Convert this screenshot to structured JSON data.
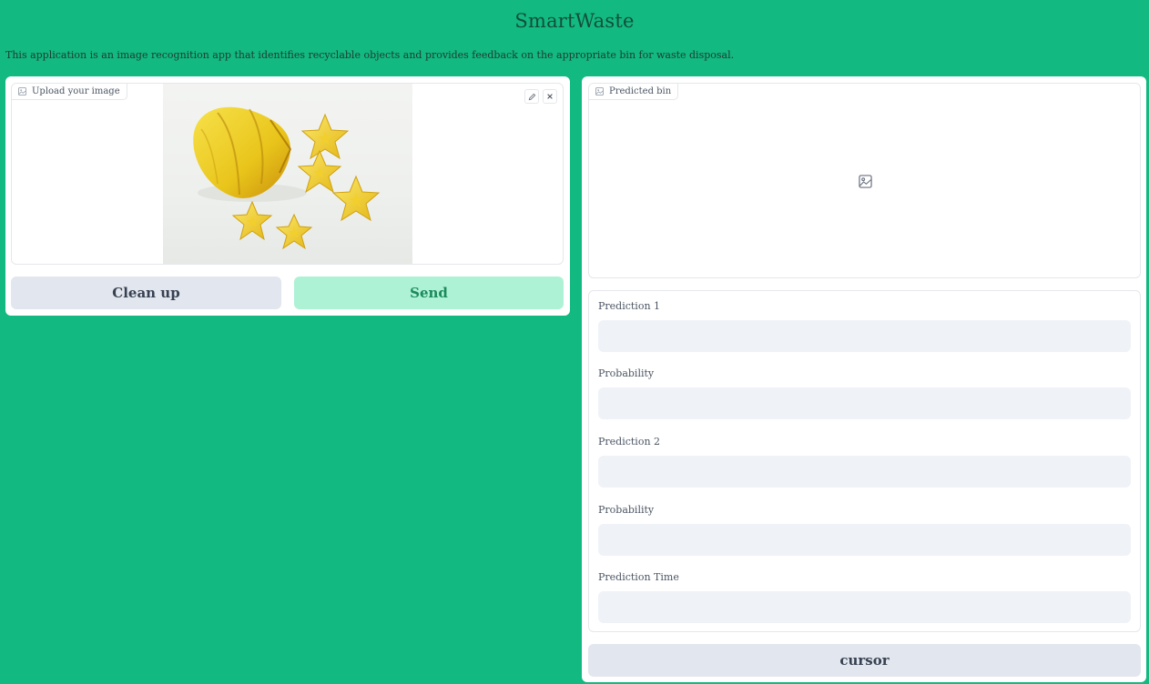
{
  "header": {
    "title": "SmartWaste",
    "description": "This application is an image recognition app that identifies recyclable objects and provides feedback on the appropriate bin for waste disposal."
  },
  "input_panel": {
    "upload_label": "Upload your image",
    "upload_icon": "image-icon",
    "edit_icon": "pencil-icon",
    "clear_icon": "close-icon",
    "clean_button": "Clean up",
    "send_button": "Send"
  },
  "output_panel": {
    "predicted_label": "Predicted bin",
    "placeholder_icon": "image-icon",
    "fields": [
      {
        "label": "Prediction 1",
        "value": ""
      },
      {
        "label": "Probability",
        "value": ""
      },
      {
        "label": "Prediction 2",
        "value": ""
      },
      {
        "label": "Probability",
        "value": ""
      },
      {
        "label": "Prediction Time",
        "value": ""
      }
    ],
    "cursor_button": "cursor"
  },
  "colors": {
    "background": "#12b981",
    "send_button_bg": "#aef2d5",
    "send_button_text": "#1b8a5c",
    "secondary_button_bg": "#e2e6ee",
    "input_bg": "#eff2f7"
  }
}
